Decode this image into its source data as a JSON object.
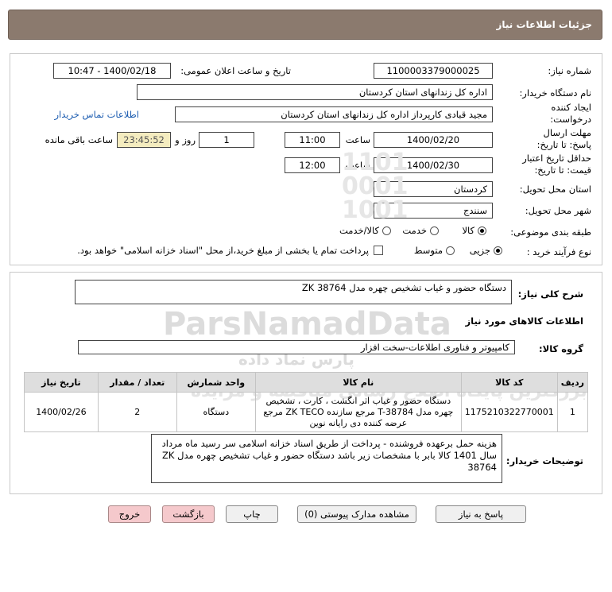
{
  "page_title": "جزئیات اطلاعات نیاز",
  "form": {
    "need_number_label": "شماره نیاز:",
    "need_number": "1100003379000025",
    "announce_label": "تاریخ و ساعت اعلان عمومی:",
    "announce_value": "1400/02/18 - 10:47",
    "buyer_label": "نام دستگاه خریدار:",
    "buyer_value": "اداره کل زندانهای استان کردستان",
    "creator_label": "ایجاد کننده درخواست:",
    "creator_value": "مجید  قبادی کارپرداز اداره کل زندانهای استان کردستان",
    "contact_link": "اطلاعات تماس خریدار",
    "deadline_label": "مهلت ارسال پاسخ: تا تاریخ:",
    "deadline_date": "1400/02/20",
    "time_label": "ساعت",
    "deadline_time": "11:00",
    "days_value": "1",
    "days_label": "روز و",
    "remaining_value": "23:45:52",
    "remaining_label": "ساعت باقی مانده",
    "validity_label": "حداقل تاریخ اعتبار قیمت: تا تاریخ:",
    "validity_date": "1400/02/30",
    "validity_time": "12:00",
    "province_label": "استان محل تحویل:",
    "province_value": "کردستان",
    "city_label": "شهر محل تحویل:",
    "city_value": "سنندج",
    "category_label": "طبقه بندی موضوعی:",
    "category_options": [
      "کالا",
      "خدمت",
      "کالا/خدمت"
    ],
    "purchase_label": "نوع فرآیند خرید :",
    "purchase_options": [
      "جزیی",
      "متوسط"
    ],
    "payment_note": "پرداخت تمام یا بخشی از مبلغ خرید،از محل \"اسناد خزانه اسلامی\" خواهد بود."
  },
  "summary": {
    "label": "شرح کلی نیاز:",
    "value": "دستگاه حضور و غیاب تشخیص چهره مدل ZK 38764",
    "goods_heading": "اطلاعات کالاهای مورد نیاز",
    "group_label": "گروه کالا:",
    "group_value": "کامپیوتر و فناوری اطلاعات-سخت افزار"
  },
  "table": {
    "headers": [
      "ردیف",
      "کد کالا",
      "نام کالا",
      "واحد شمارش",
      "تعداد / مقدار",
      "تاریخ نیاز"
    ],
    "rows": [
      {
        "index": "1",
        "code": "1175210322770001",
        "name": "دستگاه حضور و غیاب اثر انگشت ، کارت ، تشخیص چهره مدل T-38784 مرجع سازنده ZK TECO مرجع عرضه کننده دی رایانه نوین",
        "unit": "دستگاه",
        "qty": "2",
        "date": "1400/02/26"
      }
    ]
  },
  "buyer_notes": {
    "label": "توضیحات خریدار:",
    "value": "هزینه  حمل برعهده فروشنده - پرداخت از طریق  اسناد  خزانه اسلامی سر رسید ماه  مرداد سال 1401 کالا بابر با مشخصات زیر باشد دستگاه حضور و غیاب تشخیص چهره مدل ZK 38764"
  },
  "buttons": {
    "reply": "پاسخ به نیاز",
    "attachments": "مشاهده مدارک پیوستی (0)",
    "print": "چاپ",
    "back": "بازگشت",
    "exit": "خروج"
  },
  "watermark": {
    "brand": "ParsNamadData",
    "tagline": "پارس نماد داده",
    "caption": "بزرگترین پایگاه اطلاع رسانی مناقصه و مزایده"
  }
}
